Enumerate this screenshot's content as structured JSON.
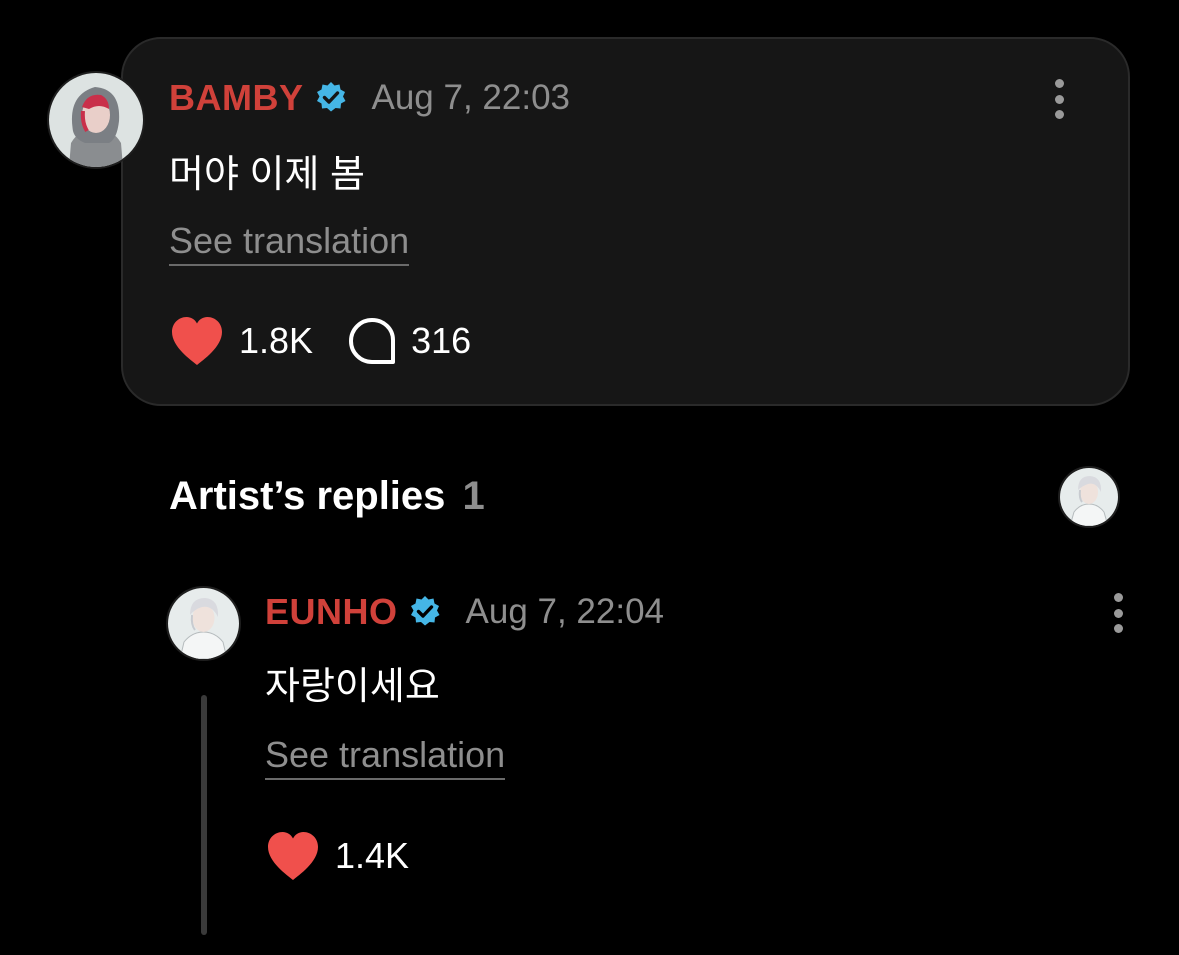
{
  "post": {
    "author": "BAMBY",
    "timestamp": "Aug 7, 22:03",
    "text": "머야 이제 봄",
    "see_translation": "See translation",
    "likes": "1.8K",
    "comments": "316"
  },
  "artist_replies": {
    "title": "Artist’s replies",
    "count": "1"
  },
  "reply": {
    "author": "EUNHO",
    "timestamp": "Aug 7, 22:04",
    "text": "자랑이세요",
    "see_translation": "See translation",
    "likes": "1.4K"
  },
  "colors": {
    "author_name": "#d0413a",
    "verified_badge": "#45b6e6",
    "heart": "#f0504c",
    "muted_text": "#8e8e8e",
    "card_background": "#161616"
  },
  "icons": {
    "verified": "verified-badge-icon",
    "like": "heart-icon",
    "comment": "speech-bubble-icon",
    "more": "more-vertical-icon"
  }
}
